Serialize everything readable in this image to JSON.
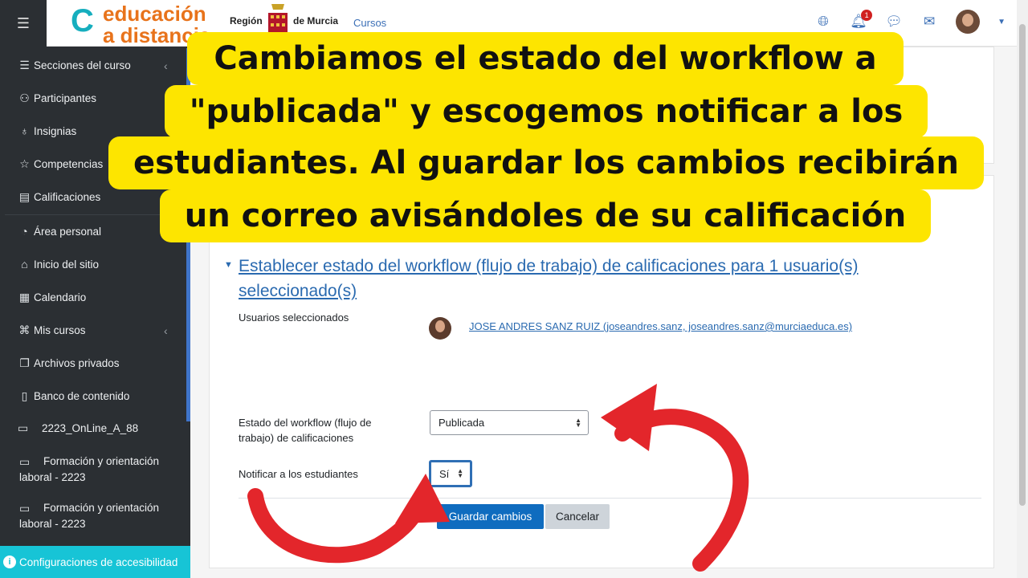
{
  "header": {
    "logo_line1": "educación",
    "logo_line2": "a distancia",
    "region_left": "Región",
    "region_right": "de Murcia",
    "cursos_link": "Cursos",
    "notification_count": "1"
  },
  "sidebar": {
    "items": [
      {
        "label": "Secciones del curso",
        "icon": "list-icon"
      },
      {
        "label": "Participantes",
        "icon": "users-icon"
      },
      {
        "label": "Insignias",
        "icon": "badge-icon"
      },
      {
        "label": "Competencias",
        "icon": "star-icon"
      },
      {
        "label": "Calificaciones",
        "icon": "grades-icon"
      },
      {
        "label": "Área personal",
        "icon": "dashboard-icon"
      },
      {
        "label": "Inicio del sitio",
        "icon": "home-icon"
      },
      {
        "label": "Calendario",
        "icon": "calendar-icon"
      },
      {
        "label": "Mis cursos",
        "icon": "courses-icon"
      },
      {
        "label": "Archivos privados",
        "icon": "files-icon"
      },
      {
        "label": "Banco de contenido",
        "icon": "content-bank-icon"
      },
      {
        "label": "2223_OnLine_A_88",
        "icon": "folder-icon"
      },
      {
        "label_1": "Formación y orientación",
        "label_2": "laboral - 2223",
        "icon": "folder-icon"
      },
      {
        "label_1": "Formación y orientación",
        "label_2": "laboral - 2223",
        "icon": "folder-icon"
      }
    ],
    "accessibility": "Configuraciones de accesibilidad"
  },
  "caption": {
    "line1": "Cambiamos el estado del workflow a",
    "line2": "\"publicada\" y escogemos notificar a los",
    "line3": "estudiantes. Al guardar los cambios recibirán",
    "line4": "un correo avisándoles de su calificación",
    "color": "#fde500"
  },
  "form": {
    "section_title": "Establecer estado del workflow (flujo de trabajo) de calificaciones para 1 usuario(s) seleccionado(s)",
    "selected_users_label": "Usuarios seleccionados",
    "selected_user": "JOSE ANDRES SANZ RUIZ (joseandres.sanz, joseandres.sanz@murciaeduca.es)",
    "workflow_label": "Estado del workflow (flujo de trabajo) de calificaciones",
    "workflow_value": "Publicada",
    "notify_label": "Notificar a los estudiantes",
    "notify_value": "Sí",
    "save_button": "Guardar cambios",
    "cancel_button": "Cancelar"
  },
  "colors": {
    "accent": "#0f6cbf",
    "sidebar_bg": "#2b2f33",
    "accessibility_bg": "#17c4d6",
    "arrow_red": "#e3262b"
  }
}
